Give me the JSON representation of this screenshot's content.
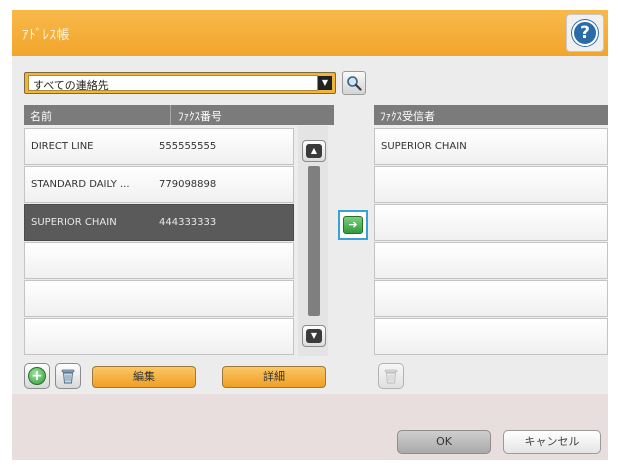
{
  "title": "ｱﾄﾞﾚｽ帳",
  "help_icon": "?",
  "filter": {
    "selected": "すべての連絡先",
    "arrow": "▼"
  },
  "contacts": {
    "headers": {
      "name": "名前",
      "fax": "ﾌｧｸｽ番号"
    },
    "rows": [
      {
        "name": "DIRECT LINE",
        "fax": "555555555",
        "selected": false
      },
      {
        "name": "STANDARD DAILY ...",
        "fax": "779098898",
        "selected": false
      },
      {
        "name": "SUPERIOR CHAIN",
        "fax": "444333333",
        "selected": true
      }
    ]
  },
  "recipients": {
    "header": "ﾌｧｸｽ受信者",
    "rows": [
      "SUPERIOR CHAIN"
    ]
  },
  "buttons": {
    "edit": "編集",
    "details": "詳細",
    "ok": "OK",
    "cancel": "キャンセル"
  },
  "icons": {
    "help": "help-icon",
    "search": "search-icon",
    "add": "plus-icon",
    "delete": "trash-icon",
    "scroll_up": "chevron-up-icon",
    "scroll_down": "chevron-down-icon",
    "add_recipient": "arrow-right-icon"
  },
  "colors": {
    "title_bar": "#f2a52c",
    "selected_row": "#5a5a5a",
    "header": "#7b7b7b",
    "accent_button": "#ef9f23"
  }
}
